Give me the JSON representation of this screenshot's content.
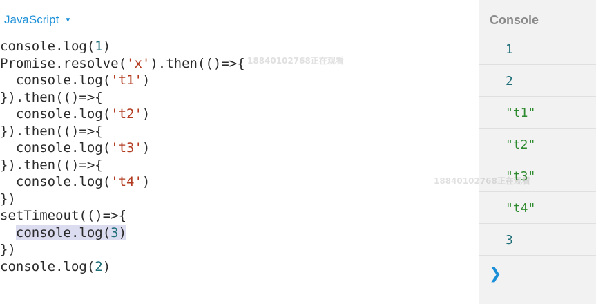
{
  "editor": {
    "language": "JavaScript",
    "lines": [
      [
        {
          "t": "console.log("
        },
        {
          "t": "1",
          "c": "num"
        },
        {
          "t": ")"
        }
      ],
      [
        {
          "t": "Promise.resolve("
        },
        {
          "t": "'x'",
          "c": "str"
        },
        {
          "t": ").then(()=>{"
        }
      ],
      [
        {
          "t": "  console.log("
        },
        {
          "t": "'t1'",
          "c": "str"
        },
        {
          "t": ")"
        }
      ],
      [
        {
          "t": "}).then(()=>{"
        }
      ],
      [
        {
          "t": "  console.log("
        },
        {
          "t": "'t2'",
          "c": "str"
        },
        {
          "t": ")"
        }
      ],
      [
        {
          "t": "}).then(()=>{"
        }
      ],
      [
        {
          "t": "  console.log("
        },
        {
          "t": "'t3'",
          "c": "str"
        },
        {
          "t": ")"
        }
      ],
      [
        {
          "t": "}).then(()=>{"
        }
      ],
      [
        {
          "t": "  console.log("
        },
        {
          "t": "'t4'",
          "c": "str"
        },
        {
          "t": ")"
        }
      ],
      [
        {
          "t": "})"
        }
      ],
      [
        {
          "t": "setTimeout(()=>{"
        }
      ],
      [
        {
          "t": "  "
        },
        {
          "t": "console.log(",
          "hl": true
        },
        {
          "t": "3",
          "c": "num",
          "hl": true
        },
        {
          "t": ")",
          "hl": true
        }
      ],
      [
        {
          "t": "})"
        }
      ],
      [
        {
          "t": "console.log("
        },
        {
          "t": "2",
          "c": "num"
        },
        {
          "t": ")"
        }
      ]
    ]
  },
  "watermarks": [
    "18840102768正在观看",
    "18840102768正在观看"
  ],
  "console": {
    "title": "Console",
    "outputs": [
      {
        "text": "1",
        "kind": "num"
      },
      {
        "text": "2",
        "kind": "num"
      },
      {
        "text": "\"t1\"",
        "kind": "str"
      },
      {
        "text": "\"t2\"",
        "kind": "str"
      },
      {
        "text": "\"t3\"",
        "kind": "str"
      },
      {
        "text": "\"t4\"",
        "kind": "str"
      },
      {
        "text": "3",
        "kind": "num"
      }
    ],
    "prompt_icon": "chevron-right-icon"
  }
}
